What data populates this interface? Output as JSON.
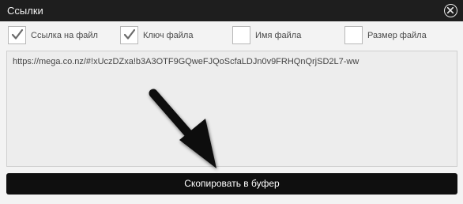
{
  "dialog": {
    "title": "Ссылки"
  },
  "options": [
    {
      "label": "Ссылка на файл",
      "checked": true
    },
    {
      "label": "Ключ файла",
      "checked": true
    },
    {
      "label": "Имя файла",
      "checked": false
    },
    {
      "label": "Размер файла",
      "checked": false
    }
  ],
  "link": {
    "value": "https://mega.co.nz/#!xUczDZxa!b3A3OTF9GQweFJQoScfaLDJn0v9FRHQnQrjSD2L7-ww"
  },
  "copy_button": {
    "label": "Скопировать в буфер"
  },
  "colors": {
    "titlebar": "#1e1e1e",
    "button": "#0f0f0f"
  }
}
